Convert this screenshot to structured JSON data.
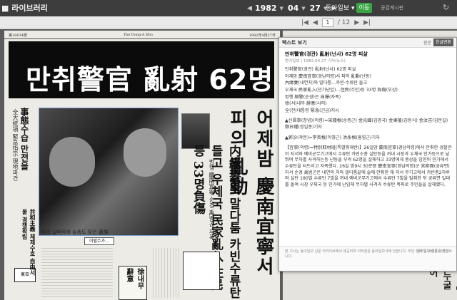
{
  "app": {
    "brand": "라이브러리",
    "date": {
      "year": "1982",
      "month": "04",
      "day": "27"
    },
    "paper": "동아일보",
    "go_label": "이동",
    "notice_label": "공감게시판",
    "refresh_icon": "refresh-icon"
  },
  "pager": {
    "current": "1",
    "total": "/ 12"
  },
  "newspaper": {
    "header_left": "第18634號",
    "header_center": "The Dong-A Ilbo",
    "header_right": "1982年4月27日",
    "headline": "만취警官 亂射 62명 피살",
    "left_title": "事態수습 만전을",
    "left_sub": "全大統領 緊急指示 現地파견",
    "left_logo": "東亞",
    "left_strip": "共和主義 체제수호 自由서울 경쟁확립",
    "photo_caption": "피의 날벼락에 슬픔도 잊은 遺族",
    "caption_button": "이럴수가…",
    "vertical_headline": "어제밤 慶南宜寧서 피의 亂動",
    "vertical_sub": "内緣妻와 말다툼 카빈수류탄들고 우체국 民家亂入 住民등 33명負傷",
    "vertical_sub2": "범행 慶南宜寧 순경 禹범곤 자폭",
    "map_title": "徐내무 辭意"
  },
  "next_page": {
    "vertical_text": "「순시」의 누굴 빌어"
  },
  "panel": {
    "title": "텍스트 보기",
    "tab_original": "원문",
    "tab_hanja": "한글변환",
    "article_title": "만취警官(경관) 亂射(난사) 62명 피살",
    "meta": "동아일보 | 1982.04.27 기사(뉴스)",
    "lines": [
      "만취警官(경관) 亂射(난사) 62명 피살",
      "어제밤 慶南宜寧(경남의령)서 피의 亂動(난동)",
      "內緣妻(내연처)와 말다툼…카빈·수류탄 들고",
      "우체국 民家亂入(민가난입)…住民(주민)등 33명 負傷(부상)",
      "범행 順警(순경)은 自爆(자폭)",
      "徐(서)내무 辭意(사의)",
      "全(전)대통령 緊急(긴급)지시"
    ],
    "paragraph_1": "▲신昌寧(창녕)(의령)=宋鍾根(송종근) 金光國(김광국) 金東植(김동식) 金汶吉(김문길) 鄭日鍾(정일종)기자",
    "paragraph_2": "▲郭汾(곽분)=李英根(이영근) 洪永根(홍영근)기자",
    "paragraph_3": "【宜寧(의령)=特別取材班(특별취재반)】26일밤 慶南宜寧(경남의령)에서 만취한 경찰관이 지서와 예비군무기고에서 수류탄 카빈소총 실탄등을 꺼내 시장과 우체국 민가등으로 날뛰며 무차별 사격하는등 난동을 부려 62명을 살해하고 33명에게 중상을 입힌뒤 민가에서 수류탄을 터뜨리고 자폭했다. 26일 밤9시 30분쯤 慶南宜寧(경남의령)군 宮柳面(궁류면) 지서 순경 禹범곤은 내연의 처와 말다툼끝에 술에 만취한 채 지서 무기고에서 카빈총2자루와 실탄 180발 수류탄 7발을 꺼내 예비군무기고에서 수류탄 7발을 탈취한 뒤 궁류면 일대를 돌며 시장 우체국 등 민가에 난입해 무차별 사격과 수류탄 폭파로 주민들을 살해했다.",
    "footer_left": "본 기사는 동아일보 신문 아카이브에서 제공되며 저작권은 동아일보사에 있습니다. 무단 전재 및 재배포를 금합니다.",
    "footer_right": "동아일보 신문 아카이브"
  }
}
